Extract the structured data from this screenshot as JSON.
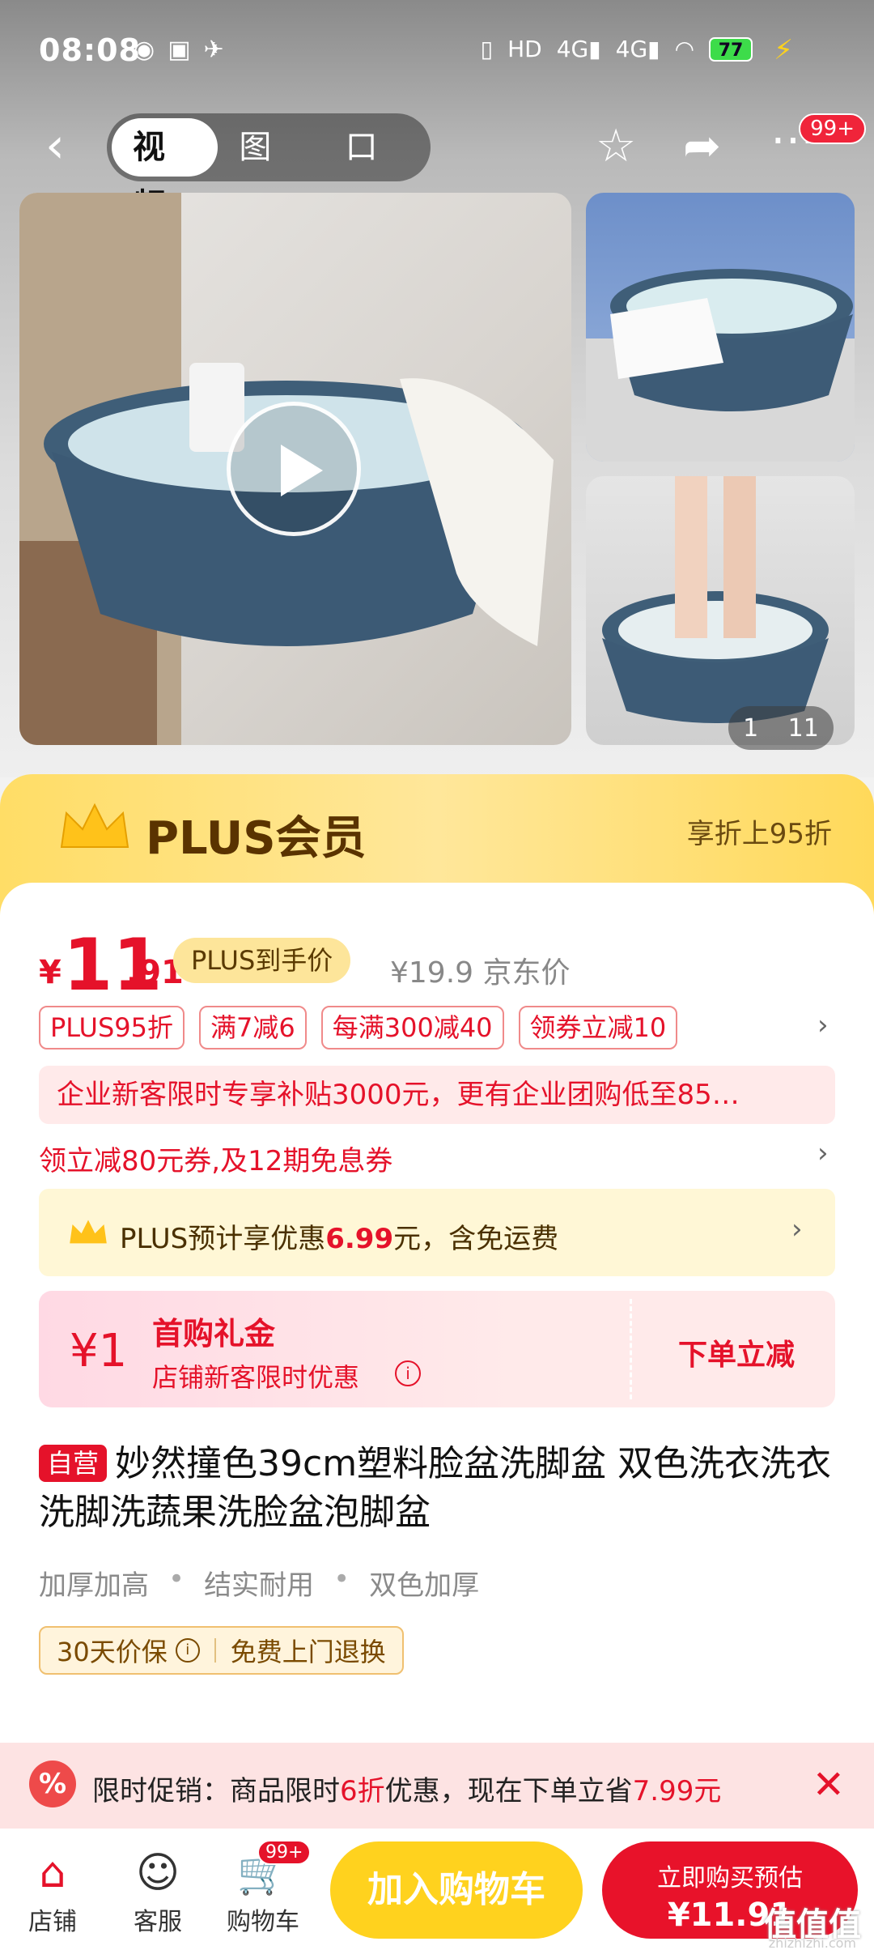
{
  "status_bar": {
    "time": "08:08",
    "battery": "77"
  },
  "nav": {
    "tabs": [
      {
        "label": "视频"
      },
      {
        "label": "图集"
      },
      {
        "label": "口碑"
      }
    ],
    "badge": "99+"
  },
  "gallery": {
    "counter_current": "1",
    "counter_total": "11"
  },
  "plus": {
    "title": "PLUS会员",
    "right_text": "享折上95折"
  },
  "price": {
    "currency": "¥",
    "integer": "11",
    "decimal": ".91",
    "plus_label": "PLUS到手价",
    "jd_price": "¥19.9 京东价"
  },
  "tags": [
    {
      "label": "PLUS95折"
    },
    {
      "label": "满7减6"
    },
    {
      "label": "每满300减40"
    },
    {
      "label": "领券立减10"
    }
  ],
  "promo_banner": "企业新客限时专享补贴3000元，更有企业团购低至85…",
  "coupon_line": "领立减80元券,及12期免息券",
  "plus_estimate": {
    "prefix": "PLUS预计享优惠",
    "amount": "6.99",
    "suffix": "元，含免运费"
  },
  "gift": {
    "symbol": "¥1",
    "title": "首购礼金",
    "subtitle": "店铺新客限时优惠",
    "action": "下单立减"
  },
  "product": {
    "self_tag": "自营",
    "title": "妙然撞色39cm塑料脸盆洗脚盆 双色洗衣洗衣洗脚洗蔬果洗脸盆泡脚盆",
    "features": [
      "加厚加高",
      "结实耐用",
      "双色加厚"
    ],
    "guarantees": [
      "30天价保",
      "免费上门退换"
    ]
  },
  "limited": {
    "prefix": "限时促销：商品限时",
    "discount": "6折",
    "middle": "优惠，现在下单立省",
    "saving": "7.99元"
  },
  "bottom": {
    "shop": "店铺",
    "service": "客服",
    "cart": "购物车",
    "cart_badge": "99+",
    "add_cart": "加入购物车",
    "buy_line1": "立即购买预估",
    "buy_line2": "¥11.91"
  },
  "watermark": "值值值",
  "watermark_sub": "zhizhizhi.com",
  "colors": {
    "accent_red": "#e5122a",
    "plus_gold": "#ffd95a",
    "cart_yellow": "#ffd21e"
  }
}
